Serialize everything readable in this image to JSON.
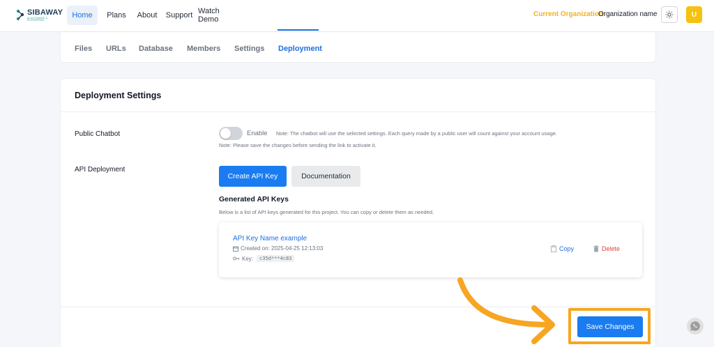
{
  "brand": {
    "name": "SIBAWAY",
    "tagline": "AI AUTOMATE & ENTERPRISE"
  },
  "nav": {
    "items": [
      {
        "label": "Home",
        "active": true
      },
      {
        "label": "Plans",
        "active": false
      },
      {
        "label": "About",
        "active": false
      },
      {
        "label": "Support",
        "active": false
      },
      {
        "label": "Watch Demo",
        "active": false
      }
    ]
  },
  "org": {
    "label": "Current Organization:",
    "name": "Organization name"
  },
  "user": {
    "initial": "U"
  },
  "tabs": [
    {
      "label": "Files",
      "active": false
    },
    {
      "label": "URLs",
      "active": false
    },
    {
      "label": "Database",
      "active": false
    },
    {
      "label": "Members",
      "active": false
    },
    {
      "label": "Settings",
      "active": false
    },
    {
      "label": "Deployment",
      "active": true
    }
  ],
  "deployment": {
    "title": "Deployment Settings",
    "public_chatbot": {
      "label": "Public Chatbot",
      "toggle_label": "Enable",
      "enabled": false,
      "note": "Note: The chatbot will use the selected settings. Each query made by a public user will count against your account usage.",
      "note2": "Note: Please save the changes before sending the link to activate it."
    },
    "api": {
      "label": "API Deployment",
      "create_label": "Create API Key",
      "docs_label": "Documentation",
      "generated_title": "Generated API Keys",
      "generated_sub": "Below is a list of API keys generated for this project. You can copy or delete them as needed.",
      "key": {
        "name": "API Key Name example",
        "created": "Created on: 2025-04-25 12:13:03",
        "key_label": "Key:",
        "key_value": "c35d***4c83",
        "copy_label": "Copy",
        "delete_label": "Delete"
      }
    },
    "save_label": "Save Changes"
  },
  "colors": {
    "primary": "#1a7cf0",
    "annotation": "#f6a623",
    "org_label": "#f3b21c",
    "danger": "#e0443b"
  }
}
